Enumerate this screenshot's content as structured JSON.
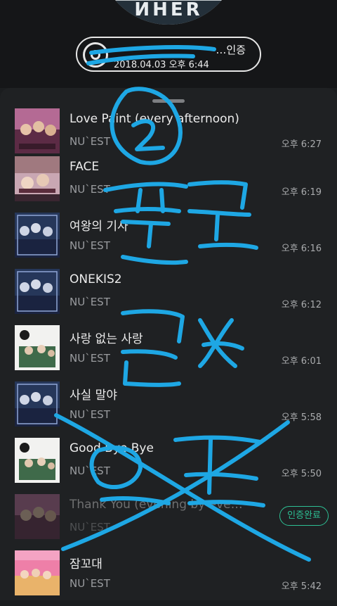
{
  "header": {
    "disc_text": "ИHER",
    "pill_title": "…인증",
    "pill_date": "2018.04.03 오후 6:44"
  },
  "songs": [
    {
      "title": "Love Paint (every afternoon)",
      "artist": "NU`EST",
      "time": "오후 6:27",
      "cover": "nuest-w"
    },
    {
      "title": "FACE",
      "artist": "NU`EST",
      "time": "오후 6:19",
      "cover": "face"
    },
    {
      "title": "여왕의 기사",
      "artist": "NU`EST",
      "time": "오후 6:16",
      "cover": "w-blue"
    },
    {
      "title": "ONEKIS2",
      "artist": "NU`EST",
      "time": "오후 6:12",
      "cover": "w-blue"
    },
    {
      "title": "사랑 없는 사랑",
      "artist": "NU`EST",
      "time": "오후 6:01",
      "cover": "white-group"
    },
    {
      "title": "사실 말야",
      "artist": "NU`EST",
      "time": "오후 5:58",
      "cover": "w-blue"
    },
    {
      "title": "Good Bye Bye",
      "artist": "NU`EST",
      "time": "오후 5:50",
      "cover": "white-group"
    },
    {
      "title": "Thank You (evening by eve…",
      "artist": "NU`EST",
      "badge": "인증완료",
      "cover": "nuest-w"
    },
    {
      "title": "잠꼬대",
      "artist": "NU`EST",
      "time": "오후 5:42",
      "cover": "sleeptalk"
    }
  ],
  "overlay_scribble": {
    "circled_number": "②",
    "text_line_1": "팬톡",
    "text_line_2": "글",
    "text_line_3": "엘턴"
  },
  "colors": {
    "accent": "#2dc094",
    "scribble": "#1ea7e4"
  }
}
